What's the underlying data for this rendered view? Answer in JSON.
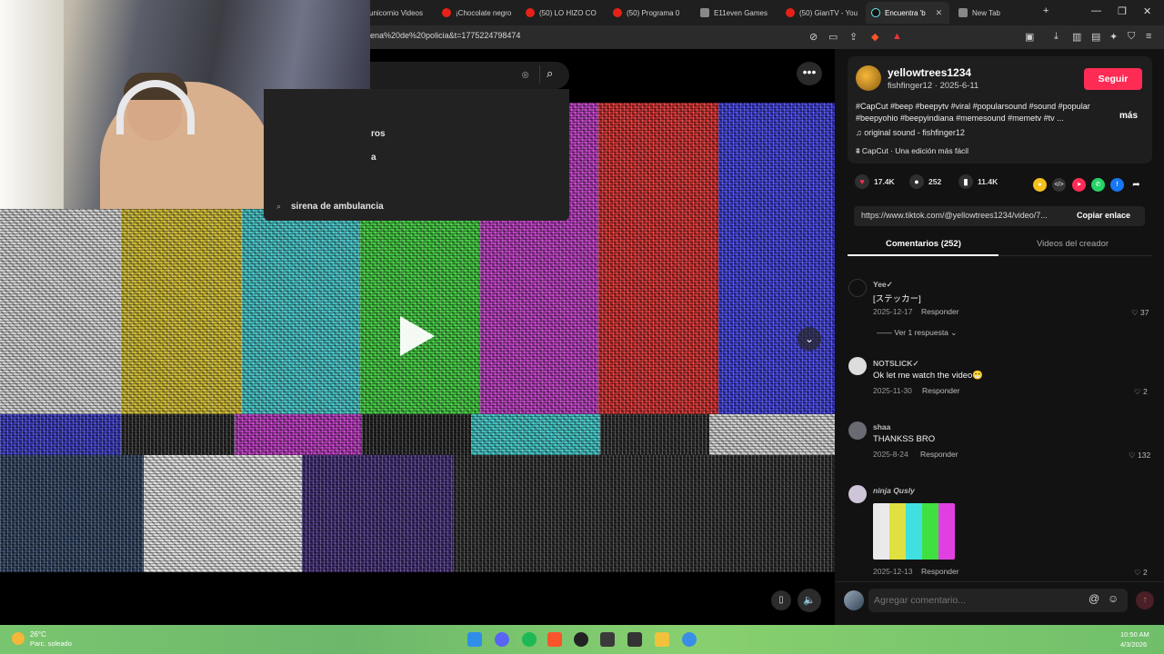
{
  "browser": {
    "tabs": [
      {
        "label": "unicornio Videos",
        "icon": "grid-icon"
      },
      {
        "label": "¡Chocolate negro",
        "icon": "youtube-icon"
      },
      {
        "label": "(50) LO HIZO CO",
        "icon": "youtube-icon"
      },
      {
        "label": "(50) Programa 0",
        "icon": "youtube-icon"
      },
      {
        "label": "E11even Games",
        "icon": "grid-icon"
      },
      {
        "label": "(50) GianTV - You",
        "icon": "youtube-icon"
      },
      {
        "label": "Encuentra 'b",
        "icon": "tiktok-icon",
        "active": true
      },
      {
        "label": "New Tab",
        "icon": "shield-icon"
      }
    ],
    "url": "ena%20de%20policia&t=1775224798474"
  },
  "search": {
    "dropdown_items": [
      "ros",
      "a",
      "sirena de ambulancia"
    ]
  },
  "post": {
    "username": "yellowtrees1234",
    "handle": "fishfinger12",
    "date": "2025-6-11",
    "follow_label": "Seguir",
    "description": "#CapCut #beep #beepytv #viral #popularsound #sound #popular #beepyohio #beepyindiana #memesound #memetv #tv ...",
    "more_label": "más",
    "sound": "original sound - fishfinger12",
    "capcut": "CapCut · Una edición más fácil",
    "likes": "17.4K",
    "comments": "252",
    "saves": "11.4K",
    "link": "https://www.tiktok.com/@yellowtrees1234/video/7...",
    "copy_label": "Copiar enlace",
    "tab_comments": "Comentarios (252)",
    "tab_creator": "Videos del creador"
  },
  "comments": [
    {
      "name": "Yee✓",
      "text": "[ステッカー]",
      "date": "2025-12-17",
      "reply": "Responder",
      "likes": "37"
    },
    {
      "name": "NOTSLICK✓",
      "text": "Ok let me watch the video😁",
      "date": "2025-11-30",
      "reply": "Responder",
      "likes": "2"
    },
    {
      "name": "shaa",
      "text": "THANKSS BRO",
      "date": "2025-8-24",
      "reply": "Responder",
      "likes": "132"
    },
    {
      "name": "ninja Qusly",
      "text": "",
      "date": "2025-12-13",
      "reply": "Responder",
      "likes": "2"
    }
  ],
  "view_replies": "Ver 1 respuesta",
  "comment_placeholder": "Agregar comentario...",
  "taskbar": {
    "temp": "26°C",
    "weather": "Parc. soleado",
    "time": "10:50 AM",
    "date": "4/3/2026"
  },
  "colors": {
    "accent": "#fe2c55",
    "background": "#121212"
  }
}
